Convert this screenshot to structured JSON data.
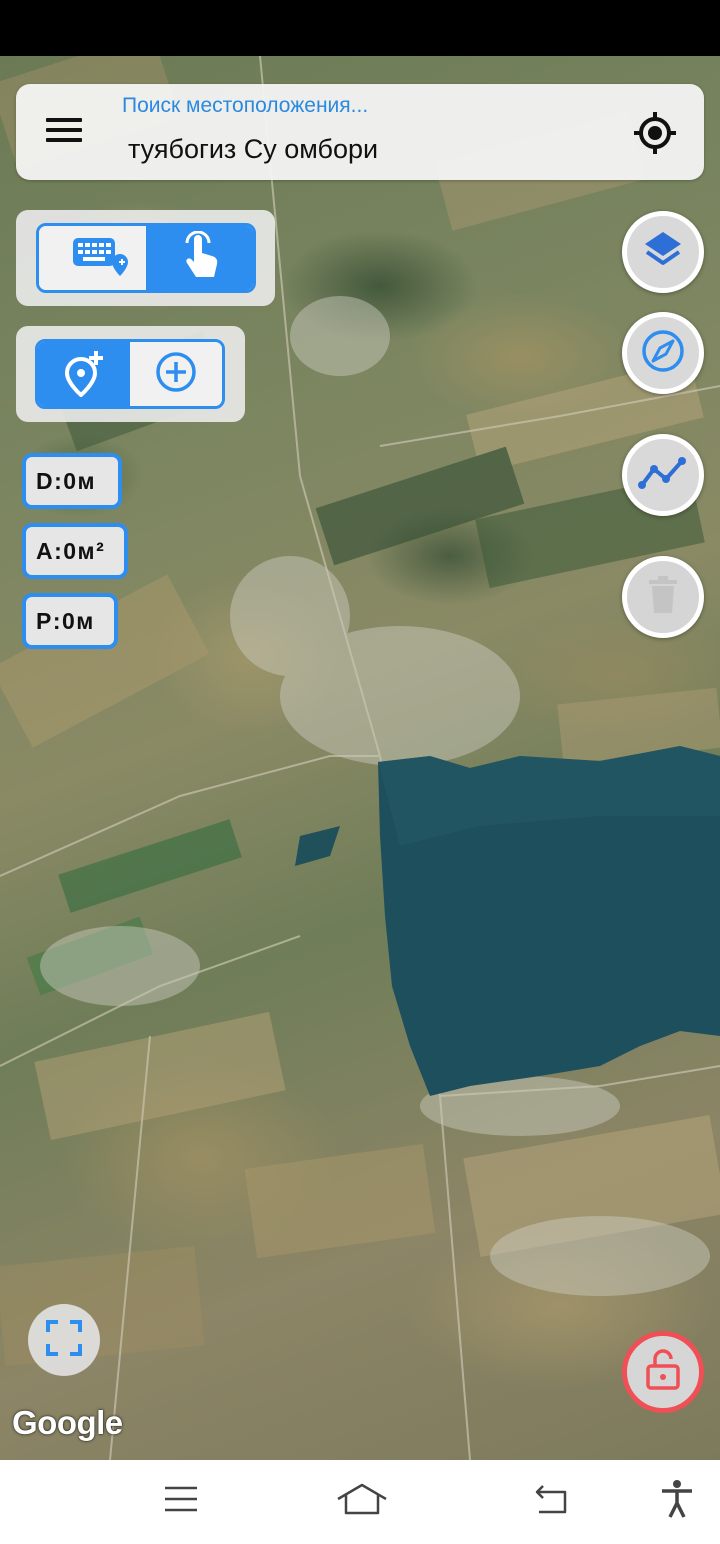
{
  "search": {
    "placeholder": "Поиск местоположения...",
    "value": "туябогиз Су омбори"
  },
  "measurements": {
    "distance": "D:0м",
    "area": "A:0м²",
    "perimeter": "P:0м"
  },
  "input_mode_toggle": {
    "selected": "touch"
  },
  "add_mode_toggle": {
    "selected": "add-point"
  },
  "map": {
    "type": "satellite",
    "attribution": "Google"
  },
  "colors": {
    "accent": "#2d8ef0",
    "lock": "#f04f55",
    "water": "#1d4f5c"
  },
  "icons": [
    "menu-icon",
    "my-location-icon",
    "keyboard-pin-icon",
    "touch-icon",
    "add-location-icon",
    "add-circle-icon",
    "layers-icon",
    "compass-icon",
    "route-icon",
    "trash-icon",
    "fullscreen-icon",
    "unlock-icon",
    "nav-menu-icon",
    "nav-home-icon",
    "nav-back-icon",
    "accessibility-icon"
  ]
}
